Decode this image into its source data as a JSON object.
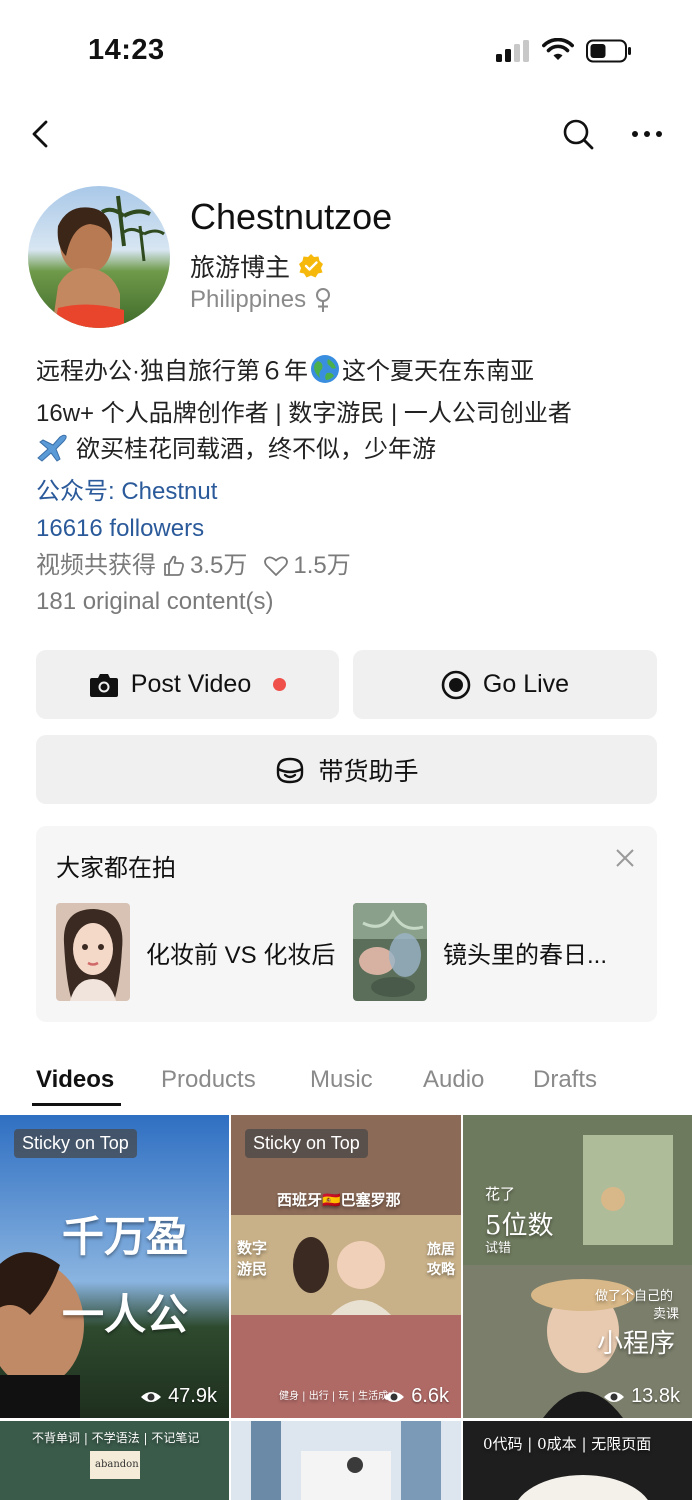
{
  "status": {
    "time": "14:23"
  },
  "profile": {
    "name": "Chestnutzoe",
    "role": "旅游博主",
    "location": "Philippines",
    "gender_icon": "female-icon",
    "verified_icon": "verified-badge-icon"
  },
  "bio": {
    "line1_a": "远程办公·独自旅行第６年",
    "line1_b": "这个夏天在东南亚",
    "line2": "16w+ 个人品牌创作者 | 数字游民 | 一人公司创业者",
    "line3": "欲买桂花同载酒，终不似，少年游",
    "account": "公众号: Chestnut",
    "followers": "16616 followers",
    "likes_prefix": "视频共获得",
    "likes": "3.5万",
    "hearts": "1.5万",
    "original": "181 original content(s)"
  },
  "actions": {
    "post_video": "Post Video",
    "go_live": "Go Live",
    "assistant": "带货助手"
  },
  "trending": {
    "title": "大家都在拍",
    "items": [
      {
        "label": "化妆前 VS 化妆后"
      },
      {
        "label": "镜头里的春日..."
      }
    ]
  },
  "tabs": [
    "Videos",
    "Products",
    "Music",
    "Audio",
    "Drafts"
  ],
  "videos": [
    {
      "sticky": "Sticky on Top",
      "views": "47.9k",
      "overlay1": "千万盈",
      "overlay2": "一人公"
    },
    {
      "sticky": "Sticky on Top",
      "views": "6.6k",
      "overlay1": "西班牙🇪🇸巴塞罗那",
      "overlay2": "数字游民",
      "overlay3": "旅居攻略",
      "overlay4": "健身 | 出行 | 玩 | 生活成本"
    },
    {
      "views": "13.8k",
      "overlay1": "花了",
      "overlay2": "5位数",
      "overlay3": "试错",
      "overlay4": "做了个自己的",
      "overlay5": "卖课",
      "overlay6": "小程序"
    },
    {
      "overlay1": "不背单词 | 不学语法 | 不记笔记",
      "overlay2": "abandon"
    },
    {},
    {
      "overlay1": "0代码 | 0成本 | 无限页面"
    }
  ],
  "colors": {
    "accent_link": "#2b5a9a",
    "button_bg": "#f0f0f0",
    "live_dot": "#f0504a",
    "verified": "#f5b80b"
  }
}
